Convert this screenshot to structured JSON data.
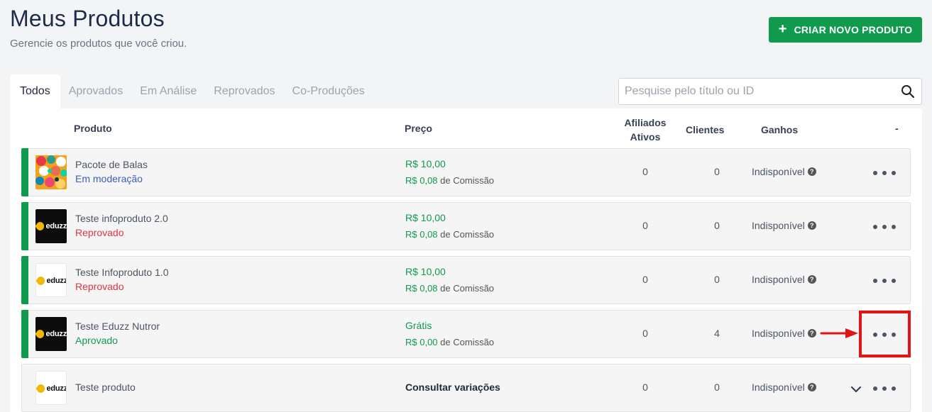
{
  "header": {
    "title": "Meus Produtos",
    "subtitle": "Gerencie os produtos que você criou.",
    "create_button": "CRIAR NOVO PRODUTO"
  },
  "tabs": [
    {
      "label": "Todos",
      "active": true
    },
    {
      "label": "Aprovados",
      "active": false
    },
    {
      "label": "Em Análise",
      "active": false
    },
    {
      "label": "Reprovados",
      "active": false
    },
    {
      "label": "Co-Produções",
      "active": false
    }
  ],
  "search": {
    "placeholder": "Pesquise pelo título ou ID",
    "value": ""
  },
  "table": {
    "columns": {
      "produto": "Produto",
      "preco": "Preço",
      "afiliados_line1": "Afiliados",
      "afiliados_line2": "Ativos",
      "clientes": "Clientes",
      "ganhos": "Ganhos",
      "actions": "-"
    },
    "commission_suffix": "de Comissão",
    "rows": [
      {
        "name": "Pacote de Balas",
        "status": "Em moderação",
        "price": "R$ 10,00",
        "commission": "R$ 0,08",
        "afiliados": "0",
        "clientes": "0",
        "ganhos": "Indisponível",
        "thumb": "candy-image"
      },
      {
        "name": "Teste infoproduto 2.0",
        "status": "Reprovado",
        "price": "R$ 10,00",
        "commission": "R$ 0,08",
        "afiliados": "0",
        "clientes": "0",
        "ganhos": "Indisponível",
        "thumb": "eduzz-dark",
        "logo_text": "eduzz"
      },
      {
        "name": "Teste Infoproduto 1.0",
        "status": "Reprovado",
        "price": "R$ 10,00",
        "commission": "R$ 0,08",
        "afiliados": "0",
        "clientes": "0",
        "ganhos": "Indisponível",
        "thumb": "eduzz-light",
        "logo_text": "eduzz"
      },
      {
        "name": "Teste Eduzz Nutror",
        "status": "Aprovado",
        "price": "Grátis",
        "commission": "R$ 0,00",
        "afiliados": "0",
        "clientes": "4",
        "ganhos": "Indisponível",
        "thumb": "eduzz-dark",
        "logo_text": "eduzz"
      },
      {
        "name": "Teste produto",
        "status": "",
        "price": "Consultar variações",
        "afiliados": "0",
        "clientes": "0",
        "ganhos": "Indisponível",
        "thumb": "eduzz-light",
        "logo_text": "eduzz"
      }
    ]
  },
  "colors": {
    "brand_green": "#0f9a4e",
    "status_moderation": "#3b5fb5",
    "status_rejected": "#dc3545",
    "annotation_red": "#e01414"
  },
  "icons": {
    "search": "search-icon",
    "plus": "plus-icon",
    "help": "question-circle-icon",
    "more": "more-dots-icon",
    "expand": "chevron-down-icon",
    "annotation": "red-arrow-icon"
  }
}
